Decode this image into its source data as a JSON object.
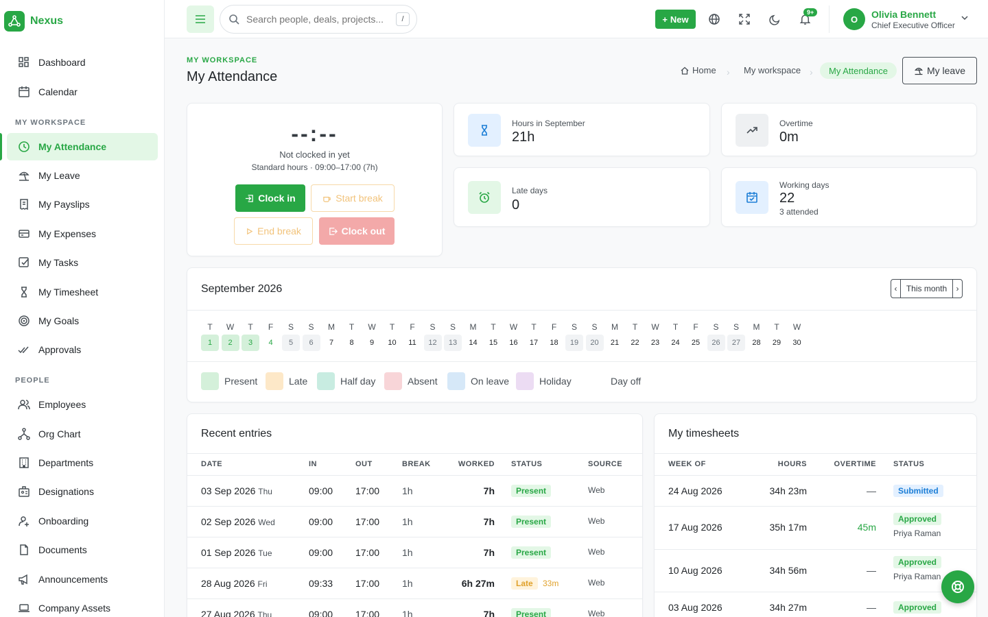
{
  "brand": {
    "name": "Nexus"
  },
  "sidebar": {
    "top_items": [
      {
        "label": "Dashboard",
        "icon": "dashboard-icon"
      },
      {
        "label": "Calendar",
        "icon": "calendar-icon"
      }
    ],
    "sections": [
      {
        "label": "MY WORKSPACE",
        "items": [
          {
            "label": "My Attendance",
            "icon": "clock-icon",
            "active": true
          },
          {
            "label": "My Leave",
            "icon": "beach-icon"
          },
          {
            "label": "My Payslips",
            "icon": "receipt-icon"
          },
          {
            "label": "My Expenses",
            "icon": "credit-card-icon"
          },
          {
            "label": "My Tasks",
            "icon": "checkbox-icon"
          },
          {
            "label": "My Timesheet",
            "icon": "hourglass-icon"
          },
          {
            "label": "My Goals",
            "icon": "target-icon"
          },
          {
            "label": "Approvals",
            "icon": "double-check-icon"
          }
        ]
      },
      {
        "label": "PEOPLE",
        "items": [
          {
            "label": "Employees",
            "icon": "users-icon"
          },
          {
            "label": "Org Chart",
            "icon": "org-chart-icon"
          },
          {
            "label": "Departments",
            "icon": "building-icon"
          },
          {
            "label": "Designations",
            "icon": "id-badge-icon"
          },
          {
            "label": "Onboarding",
            "icon": "user-plus-icon"
          },
          {
            "label": "Documents",
            "icon": "document-icon"
          },
          {
            "label": "Announcements",
            "icon": "megaphone-icon"
          },
          {
            "label": "Company Assets",
            "icon": "laptop-icon"
          }
        ]
      }
    ]
  },
  "topbar": {
    "search_placeholder": "Search people, deals, projects...",
    "search_shortcut": "/",
    "new_label": "New",
    "notification_badge": "9+",
    "user": {
      "initial": "O",
      "name": "Olivia Bennett",
      "role": "Chief Executive Officer"
    }
  },
  "page": {
    "eyebrow": "MY WORKSPACE",
    "title": "My Attendance",
    "breadcrumb": [
      "Home",
      "My workspace",
      "My Attendance"
    ],
    "my_leave_label": "My leave"
  },
  "clock_card": {
    "time": "--:--",
    "status": "Not clocked in yet",
    "standard_hours": "Standard hours · 09:00–17:00 (7h)",
    "clock_in": "Clock in",
    "start_break": "Start break",
    "end_break": "End break",
    "clock_out": "Clock out"
  },
  "stats": [
    {
      "label": "Hours in September",
      "value": "21h",
      "icon": "hourglass-icon",
      "color": "#1c7ed6"
    },
    {
      "label": "Overtime",
      "value": "0m",
      "icon": "trending-up-icon",
      "color": "#495057"
    },
    {
      "label": "Late days",
      "value": "0",
      "icon": "alarm-icon",
      "color": "#28a745"
    },
    {
      "label": "Working days",
      "value": "22",
      "sub": "3 attended",
      "icon": "calendar-check-icon",
      "color": "#1c7ed6"
    }
  ],
  "calendar": {
    "title": "September 2026",
    "this_month": "This month",
    "days": [
      {
        "dow": "T",
        "num": "1",
        "type": "present"
      },
      {
        "dow": "W",
        "num": "2",
        "type": "present"
      },
      {
        "dow": "T",
        "num": "3",
        "type": "present"
      },
      {
        "dow": "F",
        "num": "4",
        "type": "today"
      },
      {
        "dow": "S",
        "num": "5",
        "type": "off"
      },
      {
        "dow": "S",
        "num": "6",
        "type": "off"
      },
      {
        "dow": "M",
        "num": "7",
        "type": "none"
      },
      {
        "dow": "T",
        "num": "8",
        "type": "none"
      },
      {
        "dow": "W",
        "num": "9",
        "type": "none"
      },
      {
        "dow": "T",
        "num": "10",
        "type": "none"
      },
      {
        "dow": "F",
        "num": "11",
        "type": "none"
      },
      {
        "dow": "S",
        "num": "12",
        "type": "off"
      },
      {
        "dow": "S",
        "num": "13",
        "type": "off"
      },
      {
        "dow": "M",
        "num": "14",
        "type": "none"
      },
      {
        "dow": "T",
        "num": "15",
        "type": "none"
      },
      {
        "dow": "W",
        "num": "16",
        "type": "none"
      },
      {
        "dow": "T",
        "num": "17",
        "type": "none"
      },
      {
        "dow": "F",
        "num": "18",
        "type": "none"
      },
      {
        "dow": "S",
        "num": "19",
        "type": "off"
      },
      {
        "dow": "S",
        "num": "20",
        "type": "off"
      },
      {
        "dow": "M",
        "num": "21",
        "type": "none"
      },
      {
        "dow": "T",
        "num": "22",
        "type": "none"
      },
      {
        "dow": "W",
        "num": "23",
        "type": "none"
      },
      {
        "dow": "T",
        "num": "24",
        "type": "none"
      },
      {
        "dow": "F",
        "num": "25",
        "type": "none"
      },
      {
        "dow": "S",
        "num": "26",
        "type": "off"
      },
      {
        "dow": "S",
        "num": "27",
        "type": "off"
      },
      {
        "dow": "M",
        "num": "28",
        "type": "none"
      },
      {
        "dow": "T",
        "num": "29",
        "type": "none"
      },
      {
        "dow": "W",
        "num": "30",
        "type": "none"
      }
    ],
    "legend": [
      {
        "label": "Present",
        "color": "#d4f0da"
      },
      {
        "label": "Late",
        "color": "#fde8c8"
      },
      {
        "label": "Half day",
        "color": "#c8ece1"
      },
      {
        "label": "Absent",
        "color": "#f8d5d8"
      },
      {
        "label": "On leave",
        "color": "#d6e8f8"
      },
      {
        "label": "Holiday",
        "color": "#ecdcf3"
      },
      {
        "label": "Day off",
        "color": "#ffffff"
      }
    ]
  },
  "recent_entries": {
    "title": "Recent entries",
    "columns": [
      "DATE",
      "IN",
      "OUT",
      "BREAK",
      "WORKED",
      "STATUS",
      "SOURCE"
    ],
    "rows": [
      {
        "date": "03 Sep 2026",
        "day": "Thu",
        "in": "09:00",
        "out": "17:00",
        "break": "1h",
        "worked": "7h",
        "status": "Present",
        "late": "",
        "source": "Web"
      },
      {
        "date": "02 Sep 2026",
        "day": "Wed",
        "in": "09:00",
        "out": "17:00",
        "break": "1h",
        "worked": "7h",
        "status": "Present",
        "late": "",
        "source": "Web"
      },
      {
        "date": "01 Sep 2026",
        "day": "Tue",
        "in": "09:00",
        "out": "17:00",
        "break": "1h",
        "worked": "7h",
        "status": "Present",
        "late": "",
        "source": "Web"
      },
      {
        "date": "28 Aug 2026",
        "day": "Fri",
        "in": "09:33",
        "out": "17:00",
        "break": "1h",
        "worked": "6h 27m",
        "status": "Late",
        "late": "33m",
        "source": "Web"
      },
      {
        "date": "27 Aug 2026",
        "day": "Thu",
        "in": "09:00",
        "out": "17:00",
        "break": "1h",
        "worked": "7h",
        "status": "Present",
        "late": "",
        "source": "Web"
      }
    ]
  },
  "timesheets": {
    "title": "My timesheets",
    "columns": [
      "WEEK OF",
      "HOURS",
      "OVERTIME",
      "STATUS"
    ],
    "rows": [
      {
        "week": "24 Aug 2026",
        "hours": "34h 23m",
        "overtime": "—",
        "status": "Submitted",
        "approver": ""
      },
      {
        "week": "17 Aug 2026",
        "hours": "35h 17m",
        "overtime": "45m",
        "status": "Approved",
        "approver": "Priya Raman"
      },
      {
        "week": "10 Aug 2026",
        "hours": "34h 56m",
        "overtime": "—",
        "status": "Approved",
        "approver": "Priya Raman"
      },
      {
        "week": "03 Aug 2026",
        "hours": "34h 27m",
        "overtime": "—",
        "status": "Approved",
        "approver": ""
      }
    ]
  },
  "colors": {
    "accent": "#28a745",
    "accent_light": "#e3f7e6",
    "late": "#e0a12b",
    "danger_light": "#f3a9a9"
  }
}
